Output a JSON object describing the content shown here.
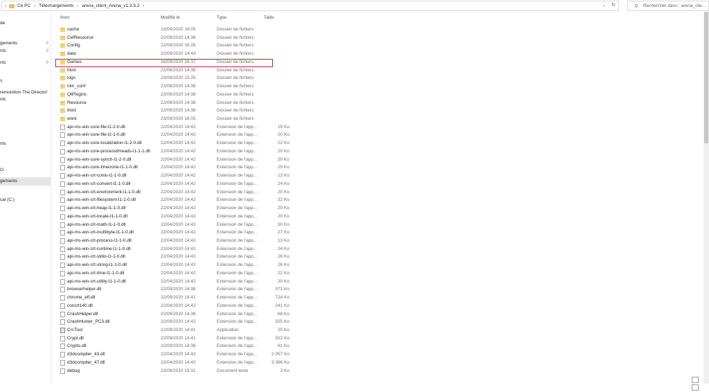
{
  "address": {
    "crumbs": [
      "Ce PC",
      "Téléchargements",
      "arena_client_Arena_v1.3.5.2"
    ]
  },
  "search": {
    "placeholder": "Rechercher dans : arena_clie..."
  },
  "sidebar": {
    "items": [
      "de",
      "gements",
      "nts",
      "nts",
      "s",
      "remonition The Director'",
      "nts",
      "nts",
      "O",
      "gements",
      "cal (C:)"
    ]
  },
  "columns": {
    "name": "Nom",
    "modified": "Modifié le",
    "type": "Type",
    "size": "Taille"
  },
  "files": [
    {
      "name": "cache",
      "date": "23/09/2020 16:05",
      "type": "Dossier de fichiers",
      "size": "",
      "kind": "folder"
    },
    {
      "name": "CefResource",
      "date": "22/09/2020 14:38",
      "type": "Dossier de fichiers",
      "size": "",
      "kind": "folder"
    },
    {
      "name": "Config",
      "date": "22/09/2020 16:28",
      "type": "Dossier de fichiers",
      "size": "",
      "kind": "folder"
    },
    {
      "name": "data",
      "date": "22/09/2020 14:43",
      "type": "Dossier de fichiers",
      "size": "",
      "kind": "folder"
    },
    {
      "name": "Games",
      "date": "16/09/2020 16:37",
      "type": "Dossier de fichiers",
      "size": "",
      "kind": "folder"
    },
    {
      "name": "html",
      "date": "22/09/2020 14:38",
      "type": "Dossier de fichiers",
      "size": "",
      "kind": "folder"
    },
    {
      "name": "logs",
      "date": "23/09/2020 15:25",
      "type": "Dossier de fichiers",
      "size": "",
      "kind": "folder"
    },
    {
      "name": "nim_conf",
      "date": "22/09/2020 14:38",
      "type": "Dossier de fichiers",
      "size": "",
      "kind": "folder"
    },
    {
      "name": "QtPlugins",
      "date": "22/09/2020 14:38",
      "type": "Dossier de fichiers",
      "size": "",
      "kind": "folder"
    },
    {
      "name": "Resource",
      "date": "22/09/2020 14:38",
      "type": "Dossier de fichiers",
      "size": "",
      "kind": "folder"
    },
    {
      "name": "third",
      "date": "22/09/2020 14:38",
      "type": "Dossier de fichiers",
      "size": "",
      "kind": "folder"
    },
    {
      "name": "work",
      "date": "23/09/2020 16:05",
      "type": "Dossier de fichiers",
      "size": "",
      "kind": "folder"
    },
    {
      "name": "api-ms-win-core-file-l1-2-0.dll",
      "date": "22/04/2020 14:42",
      "type": "Extension de l'app...",
      "size": "19 Ko",
      "kind": "file"
    },
    {
      "name": "api-ms-win-core-file-l2-1-0.dll",
      "date": "22/04/2020 14:42",
      "type": "Extension de l'app...",
      "size": "20 Ko",
      "kind": "file"
    },
    {
      "name": "api-ms-win-core-localization-l1-2-0.dll",
      "date": "22/04/2020 14:42",
      "type": "Extension de l'app...",
      "size": "22 Ko",
      "kind": "file"
    },
    {
      "name": "api-ms-win-core-processthreads-l1-1-1.dll",
      "date": "22/04/2020 14:42",
      "type": "Extension de l'app...",
      "size": "20 Ko",
      "kind": "file"
    },
    {
      "name": "api-ms-win-core-synch-l1-2-0.dll",
      "date": "22/04/2020 14:42",
      "type": "Extension de l'app...",
      "size": "20 Ko",
      "kind": "file"
    },
    {
      "name": "api-ms-win-core-timezone-l1-1-0.dll",
      "date": "22/04/2020 14:42",
      "type": "Extension de l'app...",
      "size": "20 Ko",
      "kind": "file"
    },
    {
      "name": "api-ms-win-crt-conio-l1-1-0.dll",
      "date": "22/04/2020 14:42",
      "type": "Extension de l'app...",
      "size": "13 Ko",
      "kind": "file"
    },
    {
      "name": "api-ms-win-crt-convert-l1-1-0.dll",
      "date": "22/04/2020 14:42",
      "type": "Extension de l'app...",
      "size": "24 Ko",
      "kind": "file"
    },
    {
      "name": "api-ms-win-crt-environment-l1-1-0.dll",
      "date": "22/04/2020 14:42",
      "type": "Extension de l'app...",
      "size": "20 Ko",
      "kind": "file"
    },
    {
      "name": "api-ms-win-crt-filesystem-l1-1-0.dll",
      "date": "22/04/2020 14:42",
      "type": "Extension de l'app...",
      "size": "22 Ko",
      "kind": "file"
    },
    {
      "name": "api-ms-win-crt-heap-l1-1-0.dll",
      "date": "22/04/2020 14:42",
      "type": "Extension de l'app...",
      "size": "20 Ko",
      "kind": "file"
    },
    {
      "name": "api-ms-win-crt-locale-l1-1-0.dll",
      "date": "22/04/2020 14:42",
      "type": "Extension de l'app...",
      "size": "20 Ko",
      "kind": "file"
    },
    {
      "name": "api-ms-win-crt-math-l1-1-0.dll",
      "date": "22/04/2020 14:42",
      "type": "Extension de l'app...",
      "size": "30 Ko",
      "kind": "file"
    },
    {
      "name": "api-ms-win-crt-multibyte-l1-1-0.dll",
      "date": "22/04/2020 14:42",
      "type": "Extension de l'app...",
      "size": "27 Ko",
      "kind": "file"
    },
    {
      "name": "api-ms-win-crt-process-l1-1-0.dll",
      "date": "22/04/2020 14:42",
      "type": "Extension de l'app...",
      "size": "13 Ko",
      "kind": "file"
    },
    {
      "name": "api-ms-win-crt-runtime-l1-1-0.dll",
      "date": "22/04/2020 14:42",
      "type": "Extension de l'app...",
      "size": "24 Ko",
      "kind": "file"
    },
    {
      "name": "api-ms-win-crt-stdio-l1-1-0.dll",
      "date": "22/04/2020 14:42",
      "type": "Extension de l'app...",
      "size": "26 Ko",
      "kind": "file"
    },
    {
      "name": "api-ms-win-crt-string-l1-1-0.dll",
      "date": "22/04/2020 14:42",
      "type": "Extension de l'app...",
      "size": "26 Ko",
      "kind": "file"
    },
    {
      "name": "api-ms-win-crt-time-l1-1-0.dll",
      "date": "22/04/2020 14:42",
      "type": "Extension de l'app...",
      "size": "22 Ko",
      "kind": "file"
    },
    {
      "name": "api-ms-win-crt-utility-l1-1-0.dll",
      "date": "22/04/2020 14:42",
      "type": "Extension de l'app...",
      "size": "20 Ko",
      "kind": "file"
    },
    {
      "name": "browserhelper.dll",
      "date": "22/09/2020 14:38",
      "type": "Extension de l'app...",
      "size": "371 Ko",
      "kind": "file"
    },
    {
      "name": "chrome_elf.dll",
      "date": "22/09/2020 14:41",
      "type": "Extension de l'app...",
      "size": "724 Ko",
      "kind": "file"
    },
    {
      "name": "concrt140.dll",
      "date": "22/04/2020 14:42",
      "type": "Extension de l'app...",
      "size": "241 Ko",
      "kind": "file"
    },
    {
      "name": "CrashHelper.dll",
      "date": "22/09/2020 14:38",
      "type": "Extension de l'app...",
      "size": "68 Ko",
      "kind": "file"
    },
    {
      "name": "CrashHunter_PC3.dll",
      "date": "22/09/2020 14:42",
      "type": "Extension de l'app...",
      "size": "325 Ko",
      "kind": "file"
    },
    {
      "name": "CrcTool",
      "date": "22/09/2020 14:41",
      "type": "Application",
      "size": "20 Ko",
      "kind": "app"
    },
    {
      "name": "Crypt.dll",
      "date": "22/09/2020 14:41",
      "type": "Extension de l'app...",
      "size": "322 Ko",
      "kind": "file"
    },
    {
      "name": "Crypto.dll",
      "date": "22/09/2020 14:38",
      "type": "Extension de l'app...",
      "size": "61 Ko",
      "kind": "file"
    },
    {
      "name": "d3dcompiler_43.dll",
      "date": "22/04/2020 14:42",
      "type": "Extension de l'app...",
      "size": "2 057 Ko",
      "kind": "file"
    },
    {
      "name": "d3dcompiler_47.dll",
      "date": "22/04/2020 14:42",
      "type": "Extension de l'app...",
      "size": "3 386 Ko",
      "kind": "file"
    },
    {
      "name": "debug",
      "date": "23/09/2020 15:31",
      "type": "Document texte",
      "size": "3 Ko",
      "kind": "file"
    }
  ]
}
